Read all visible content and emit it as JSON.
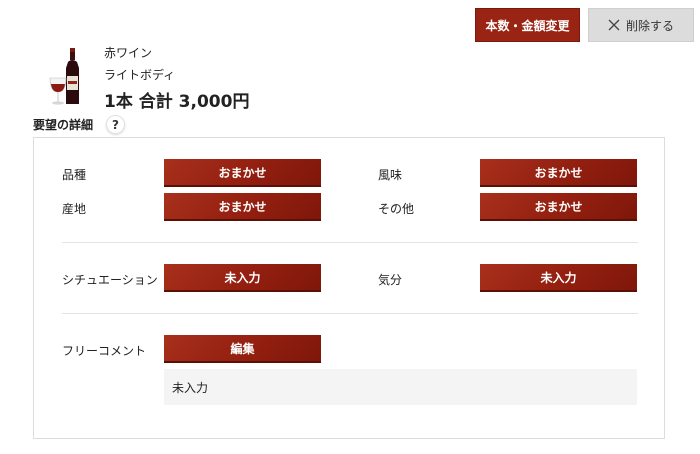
{
  "header": {
    "change_button": "本数・金額変更",
    "delete_button": "削除する"
  },
  "wine": {
    "type": "赤ワイン",
    "body": "ライトボディ",
    "total": "1本 合計 3,000円"
  },
  "details": {
    "title": "要望の詳細",
    "help": "?",
    "variety_label": "品種",
    "variety_value": "おまかせ",
    "flavor_label": "風味",
    "flavor_value": "おまかせ",
    "origin_label": "産地",
    "origin_value": "おまかせ",
    "other_label": "その他",
    "other_value": "おまかせ",
    "situation_label": "シチュエーション",
    "situation_value": "未入力",
    "mood_label": "気分",
    "mood_value": "未入力",
    "comment_label": "フリーコメント",
    "comment_button": "編集",
    "comment_value": "未入力"
  },
  "colors": {
    "accent": "#9a2414",
    "delete_bg": "#dcdcdc",
    "comment_bg": "#f4f4f4"
  }
}
